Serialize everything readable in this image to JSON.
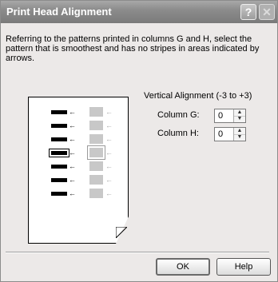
{
  "window": {
    "title": "Print Head Alignment",
    "help_glyph": "?",
    "close_glyph": "✕"
  },
  "instructions": "Referring to the patterns printed in columns G and H, select the pattern that is smoothest and has no stripes in areas indicated by arrows.",
  "alignment": {
    "heading": "Vertical Alignment (-3 to +3)",
    "column_g_label": "Column G:",
    "column_g_value": "0",
    "column_h_label": "Column H:",
    "column_h_value": "0",
    "spin_up": "▲",
    "spin_down": "▼"
  },
  "preview": {
    "arrow_glyph": "←",
    "selected_row": 3,
    "row_count": 7
  },
  "buttons": {
    "ok": "OK",
    "help": "Help"
  },
  "colors": {
    "titlebar": "#8c8c8c",
    "dialog_bg": "#ece9e8",
    "pattern_gray": "#c8c8c8"
  }
}
